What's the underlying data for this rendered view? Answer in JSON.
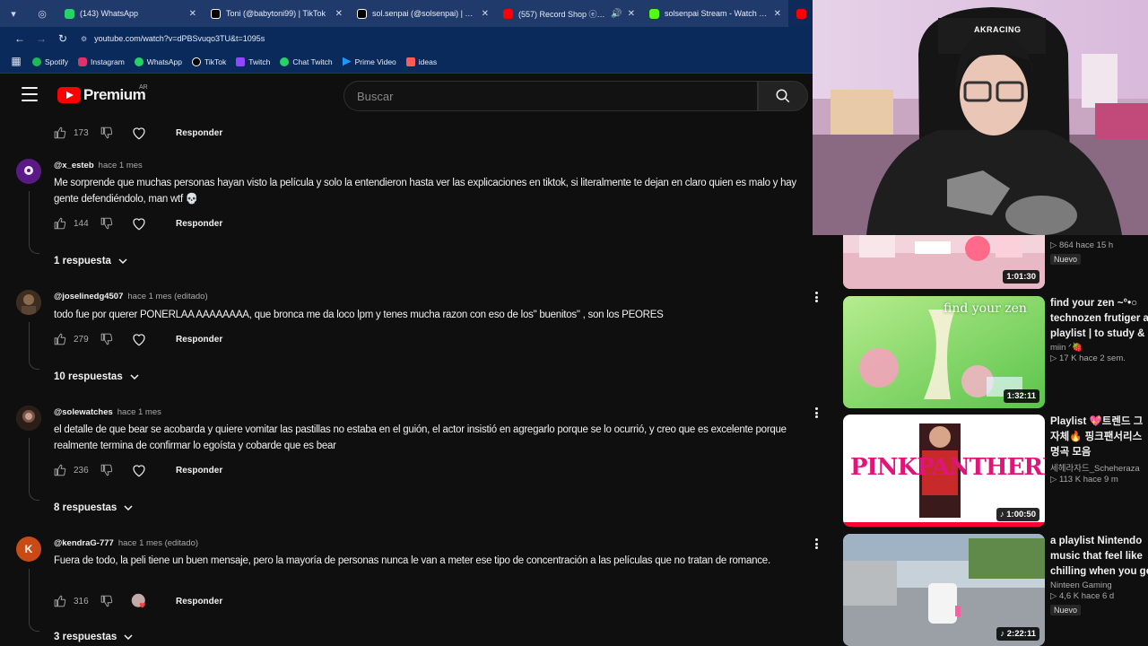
{
  "browser": {
    "tabs": [
      {
        "title": "(143) WhatsApp",
        "color": "#25d366"
      },
      {
        "title": "Toni (@babytoni99) | TikTok",
        "color": "#111111"
      },
      {
        "title": "sol.senpai (@solsenpai) | TikTok",
        "color": "#111111"
      },
      {
        "title": "(557) Record Shop ⓔ | Ch",
        "color": "#ff0000"
      },
      {
        "title": "solsenpai Stream - Watch Live",
        "color": "#53fc18"
      }
    ],
    "url": "youtube.com/watch?v=dPBSvuqo3TU&t=1095s",
    "bookmarks": [
      {
        "label": "Spotify",
        "color": "#1db954"
      },
      {
        "label": "Instagram",
        "color": "#e1306c"
      },
      {
        "label": "WhatsApp",
        "color": "#25d366"
      },
      {
        "label": "TikTok",
        "color": "#111111"
      },
      {
        "label": "Twitch",
        "color": "#9146ff"
      },
      {
        "label": "Chat Twitch",
        "color": "#25d366"
      },
      {
        "label": "Prime Video",
        "color": "#1a98ff"
      },
      {
        "label": "ideas",
        "color": "#ff5a5a"
      }
    ]
  },
  "header": {
    "logo_text": "Premium",
    "country": "AR",
    "search_placeholder": "Buscar"
  },
  "comments": {
    "top_row": {
      "likes": "173",
      "reply_label": "Responder"
    },
    "items": [
      {
        "author": "@x_esteb",
        "time": "hace 1 mes",
        "text": "Me sorprende que muchas personas hayan visto la película y solo la entendieron hasta ver las explicaciones en tiktok, si literalmente te dejan en claro quien es malo y hay gente defendiéndolo, man wtf 💀",
        "likes": "144",
        "reply_label": "Responder",
        "replies": "1 respuesta",
        "avatar_color": "#6a1b9a"
      },
      {
        "author": "@joselinedg4507",
        "time": "hace 1 mes (editado)",
        "text": "todo fue por querer PONERLAA AAAAAAAA, que bronca me da loco lpm y tenes mucha razon con eso de los\" buenitos\" , son los PEORES",
        "likes": "279",
        "reply_label": "Responder",
        "replies": "10 respuestas",
        "avatar_color": "#4e3b2a"
      },
      {
        "author": "@solewatches",
        "time": "hace 1 mes",
        "text": "el detalle de que bear se acobarda y quiere vomitar las pastillas no estaba en el guión, el actor insistió en agregarlo porque se lo ocurrió, y creo que es excelente porque realmente termina de confirmar lo egoísta y cobarde que es bear",
        "likes": "236",
        "reply_label": "Responder",
        "replies": "8 respuestas",
        "avatar_color": "#5a4036"
      },
      {
        "author": "@kendraG-777",
        "time": "hace 1 mes (editado)",
        "text": "Fuera de todo, la peli tiene un buen mensaje, pero la mayoría de personas nunca le van a meter ese tipo de concentración a las películas que no tratan de romance.",
        "likes": "316",
        "reply_label": "Responder",
        "replies": "3 respuestas",
        "avatar_letter": "K",
        "avatar_color": "#c84a14"
      }
    ]
  },
  "recommendations": [
    {
      "title": "",
      "channel": "",
      "stats": "▷ 864  hace 15 h",
      "badge": "Nuevo",
      "duration": "1:01:30",
      "thumb_colors": [
        "#f3d3dc",
        "#e9a9b9"
      ]
    },
    {
      "title": "find your zen ~°•○",
      "title2": "technozen frutiger a",
      "title3": "playlist | to study & .",
      "channel": "miin ᐟ🍓",
      "stats": "▷ 17 K  hace 2 sem.",
      "duration": "1:32:11",
      "thumb_text": "find your zen",
      "thumb_colors": [
        "#7fdc5a",
        "#d9f3c8"
      ]
    },
    {
      "title": "Playlist 💖트렌드 그",
      "title2": "자체🔥 핑크팬서리스",
      "title3": "명곡 모음",
      "channel": "세헤라자드_Scheheraza",
      "stats": "▷ 113 K  hace 9 m",
      "duration": "♪ 1:00:50",
      "thumb_text": "PINKPANTHERESS",
      "thumb_colors": [
        "#ffffff",
        "#f5f5f5"
      ]
    },
    {
      "title": "a playlist Nintendo",
      "title2": "music that feel like",
      "title3": "chilling when you ge",
      "channel": "Ninteen Gaming",
      "stats": "▷ 4,6 K  hace 6 d",
      "badge": "Nuevo",
      "duration": "♪ 2:22:11",
      "thumb_colors": [
        "#c9d3dc",
        "#8c949b"
      ]
    }
  ],
  "webcam": {
    "headrest_text": "AKRACING"
  }
}
